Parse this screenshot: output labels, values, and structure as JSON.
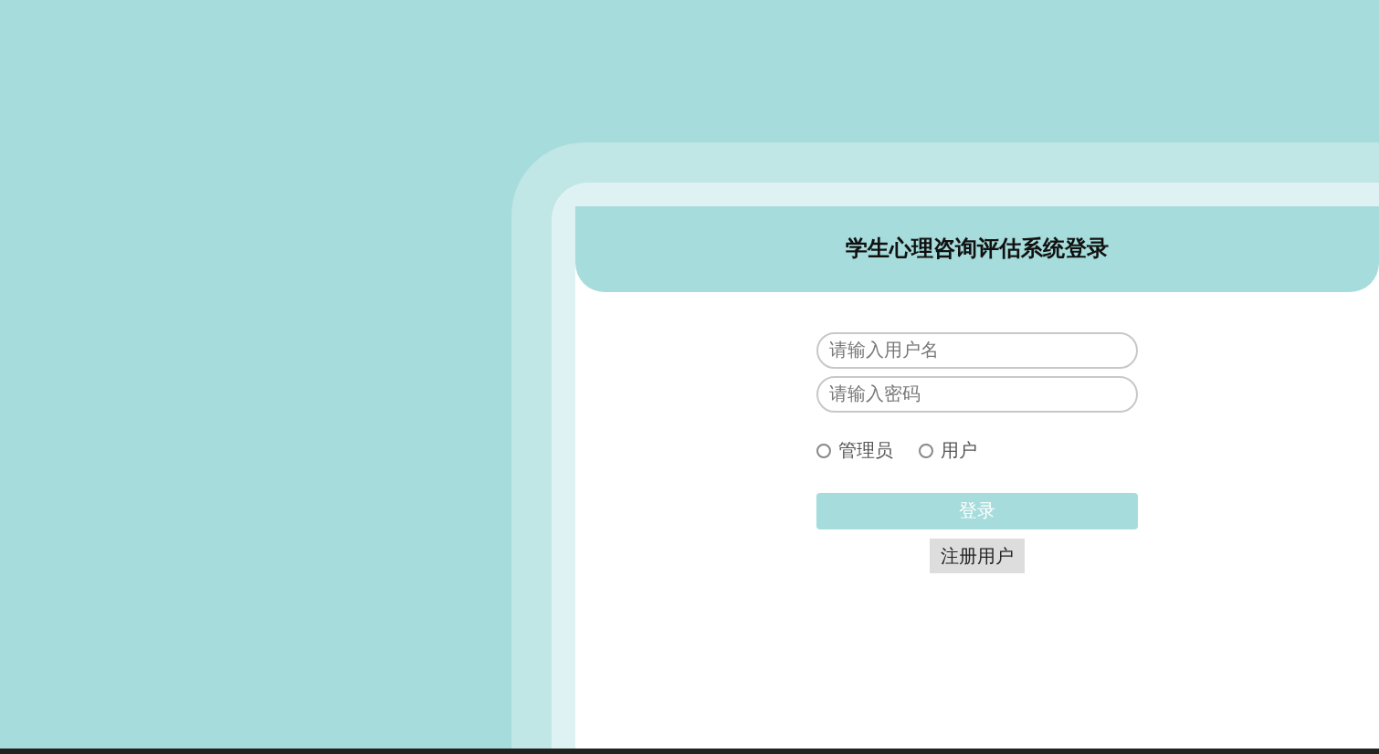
{
  "login": {
    "title": "学生心理咨询评估系统登录",
    "username": {
      "placeholder": "请输入用户名"
    },
    "password": {
      "placeholder": "请输入密码"
    },
    "roles": [
      {
        "label": "管理员",
        "selected": false
      },
      {
        "label": "用户",
        "selected": false
      }
    ],
    "login_button": "登录",
    "register_button": "注册用户"
  }
}
